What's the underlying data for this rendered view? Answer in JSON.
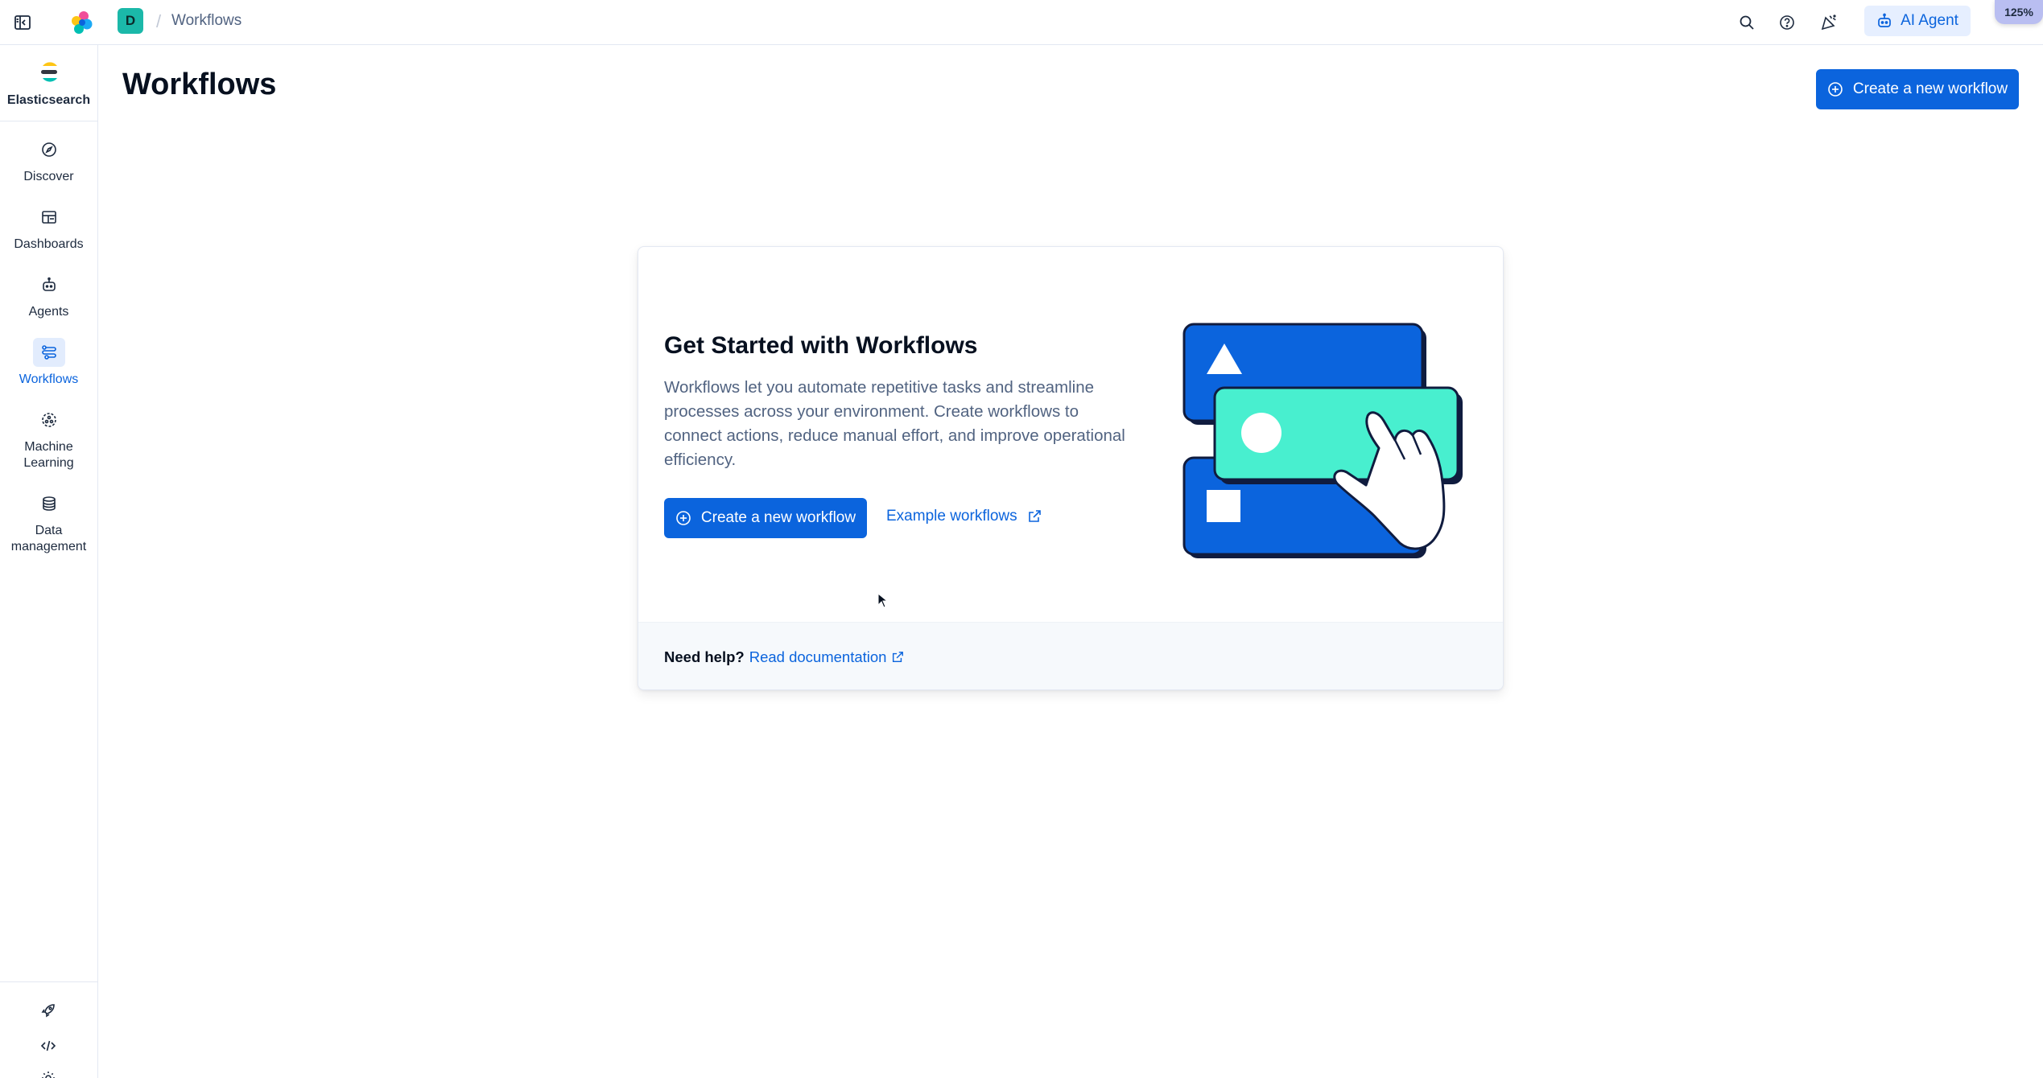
{
  "topbar": {
    "space_initial": "D",
    "breadcrumb_separator": "/",
    "breadcrumb": "Workflows",
    "ai_agent_label": "AI Agent",
    "zoom_level": "125%",
    "icons": [
      "sidebar-toggle-icon",
      "elastic-logo",
      "search-icon",
      "help-icon",
      "newsfeed-icon",
      "robot-icon"
    ]
  },
  "sidebar": {
    "brand_label": "Elasticsearch",
    "items": [
      {
        "label": "Discover",
        "icon": "compass-icon",
        "active": false
      },
      {
        "label": "Dashboards",
        "icon": "dashboard-icon",
        "active": false
      },
      {
        "label": "Agents",
        "icon": "robot-icon",
        "active": false
      },
      {
        "label": "Workflows",
        "icon": "workflow-icon",
        "active": true
      },
      {
        "label": "Machine Learning",
        "icon": "ml-icon",
        "active": false
      },
      {
        "label": "Data management",
        "icon": "database-icon",
        "active": false
      }
    ],
    "footer_icons": [
      "rocket-icon",
      "code-icon",
      "gear-icon"
    ]
  },
  "page": {
    "title": "Workflows",
    "create_button": "Create a new workflow"
  },
  "empty_state": {
    "title": "Get Started with Workflows",
    "description": "Workflows let you automate repetitive tasks and streamline processes across your environment. Create workflows to connect actions, reduce manual effort, and improve operational efficiency.",
    "create_button": "Create a new workflow",
    "example_link": "Example workflows",
    "help_label": "Need help?",
    "doc_link": "Read documentation"
  },
  "colors": {
    "accent": "#0b64dd",
    "active_nav_bg": "#e2ecfd",
    "illustration_teal": "#48efcf",
    "illustration_navy": "#101c3f"
  }
}
